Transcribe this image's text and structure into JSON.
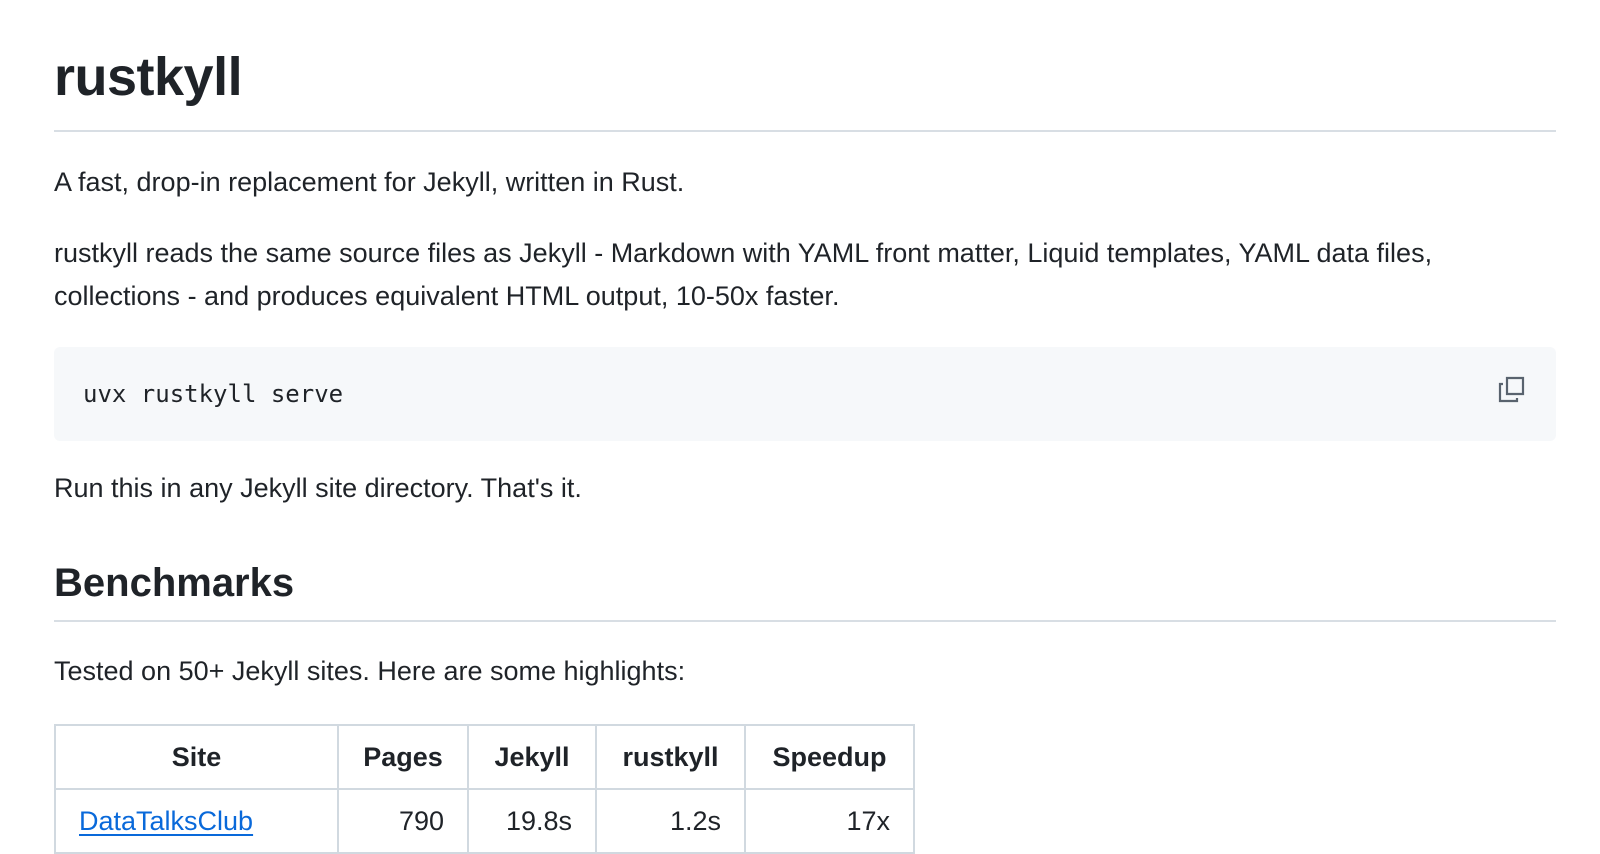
{
  "title": "rustkyll",
  "intro": "A fast, drop-in replacement for Jekyll, written in Rust.",
  "description": "rustkyll reads the same source files as Jekyll - Markdown with YAML front matter, Liquid templates, YAML data files, collections - and produces equivalent HTML output, 10-50x faster.",
  "code": "uvx rustkyll serve",
  "copy_icon": "copy-icon",
  "run_note": "Run this in any Jekyll site directory. That's it.",
  "benchmarks": {
    "heading": "Benchmarks",
    "intro": "Tested on 50+ Jekyll sites. Here are some highlights:",
    "columns": [
      "Site",
      "Pages",
      "Jekyll",
      "rustkyll",
      "Speedup"
    ],
    "rows": [
      {
        "site": "DataTalksClub",
        "pages": "790",
        "jekyll": "19.8s",
        "rustkyll": "1.2s",
        "speedup": "17x"
      }
    ]
  },
  "colors": {
    "text": "#1f2328",
    "link": "#0969da",
    "code_bg": "#f6f8fa",
    "border": "#d1d9e0"
  }
}
